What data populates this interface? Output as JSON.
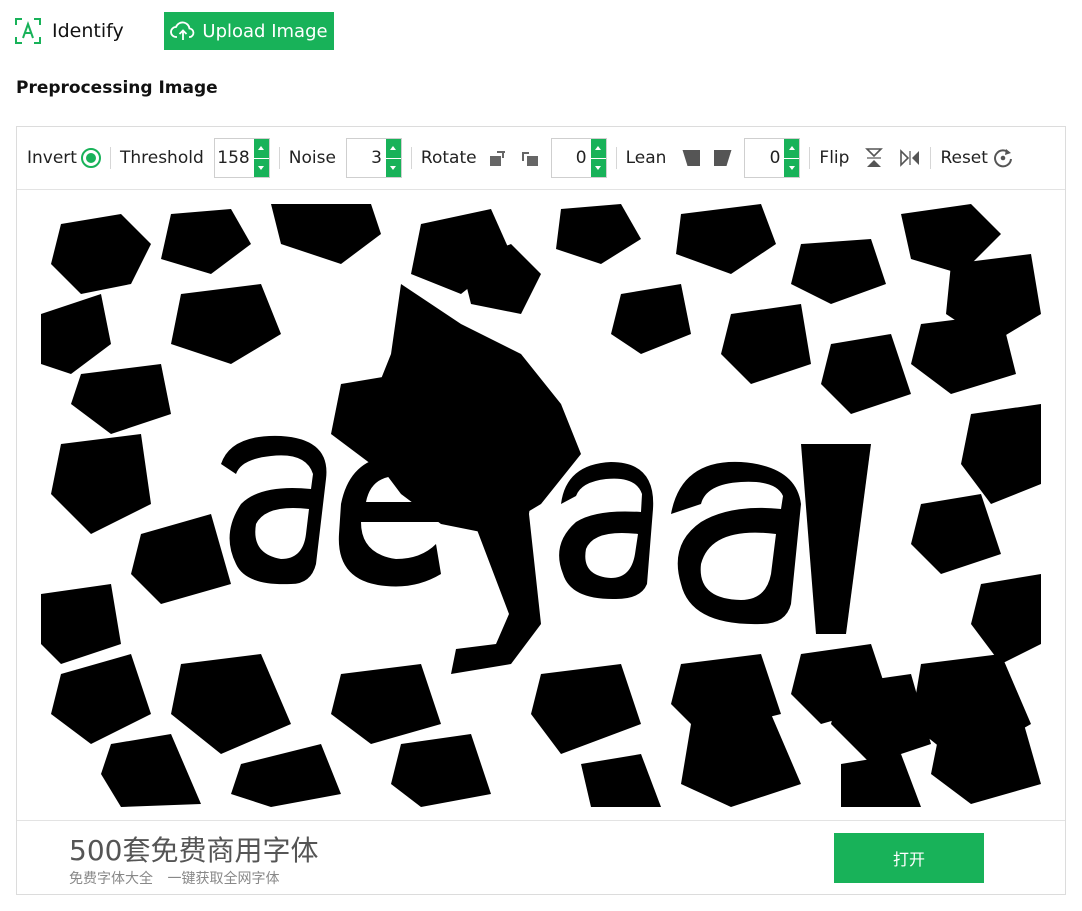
{
  "header": {
    "identify_label": "Identify",
    "upload_label": "Upload Image"
  },
  "section_title": "Preprocessing Image",
  "toolbar": {
    "invert_label": "Invert",
    "invert_checked": true,
    "threshold_label": "Threshold",
    "threshold_value": "158",
    "noise_label": "Noise",
    "noise_value": "3",
    "rotate_label": "Rotate",
    "rotate_value": "0",
    "lean_label": "Lean",
    "lean_value": "0",
    "flip_label": "Flip",
    "reset_label": "Reset"
  },
  "icons": {
    "identify": "text-scan-icon",
    "upload": "cloud-upload-icon",
    "rotate_left": "rotate-left-icon",
    "rotate_right": "rotate-right-icon",
    "lean_left": "lean-left-icon",
    "lean_right": "lean-right-icon",
    "flip_vertical": "flip-vertical-icon",
    "flip_horizontal": "flip-horizontal-icon",
    "reset": "reset-icon"
  },
  "preview": {
    "captcha_text": "aefaq"
  },
  "ad": {
    "title": "500套免费商用字体",
    "subtitle": "免费字体大全 一键获取全网字体",
    "button_label": "打开"
  },
  "colors": {
    "accent": "#18b259",
    "border": "#dcdcdc"
  }
}
